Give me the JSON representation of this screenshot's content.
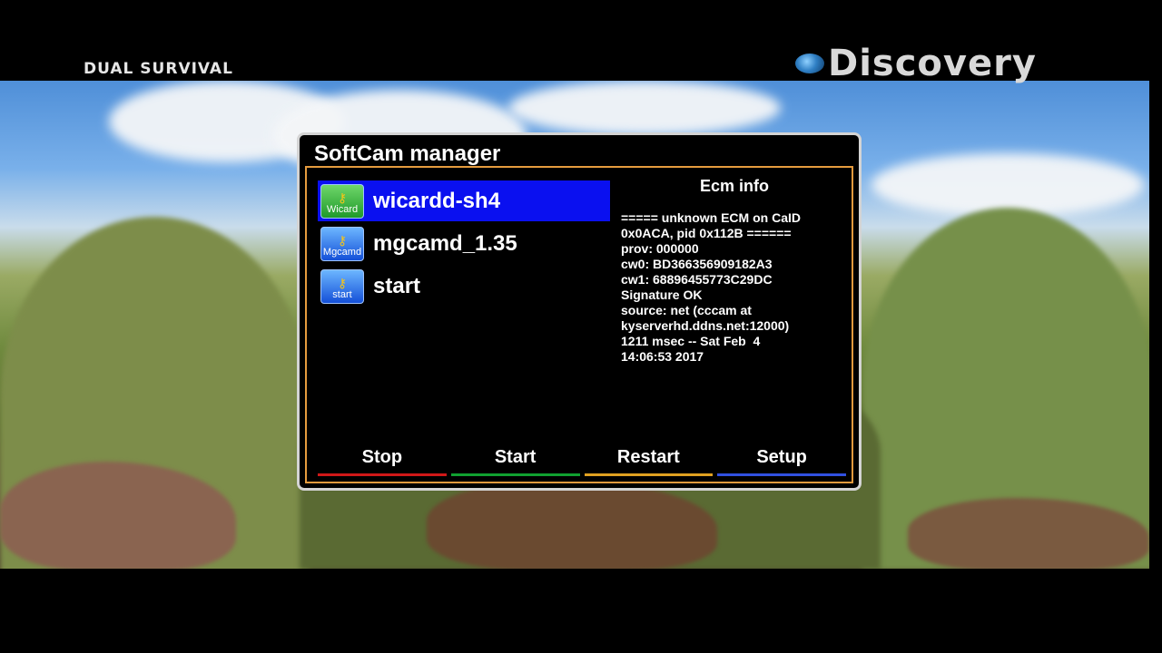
{
  "overlay": {
    "show_title": "DUAL SURVIVAL",
    "channel_logo": "Discovery"
  },
  "dialog": {
    "title": "SoftCam manager",
    "cams": [
      {
        "label": "wicardd-sh4",
        "icon_label": "Wicard",
        "icon": "key-icon",
        "selected": true,
        "icon_color": "#1f9a2a"
      },
      {
        "label": "mgcamd_1.35",
        "icon_label": "Mgcamd",
        "icon": "key-icon",
        "selected": false,
        "icon_color": "#1450d8"
      },
      {
        "label": "start",
        "icon_label": "start",
        "icon": "key-icon",
        "selected": false,
        "icon_color": "#1450d8"
      }
    ],
    "ecm": {
      "title": "Ecm info",
      "lines": [
        "===== unknown ECM on CaID",
        "0x0ACA, pid 0x112B ======",
        "prov: 000000",
        "cw0: BD366356909182A3",
        "cw1: 68896455773C29DC",
        "Signature OK",
        "source: net (cccam at",
        "kyserverhd.ddns.net:12000)",
        "1211 msec -- Sat Feb  4",
        "14:06:53 2017"
      ]
    },
    "buttons": {
      "stop": "Stop",
      "start": "Start",
      "restart": "Restart",
      "setup": "Setup"
    },
    "colors": {
      "selection": "#0a10f0",
      "border": "#e59b3e",
      "red": "#d01818",
      "green": "#10a030",
      "yellow": "#e0a020",
      "blue": "#3050e0"
    }
  }
}
